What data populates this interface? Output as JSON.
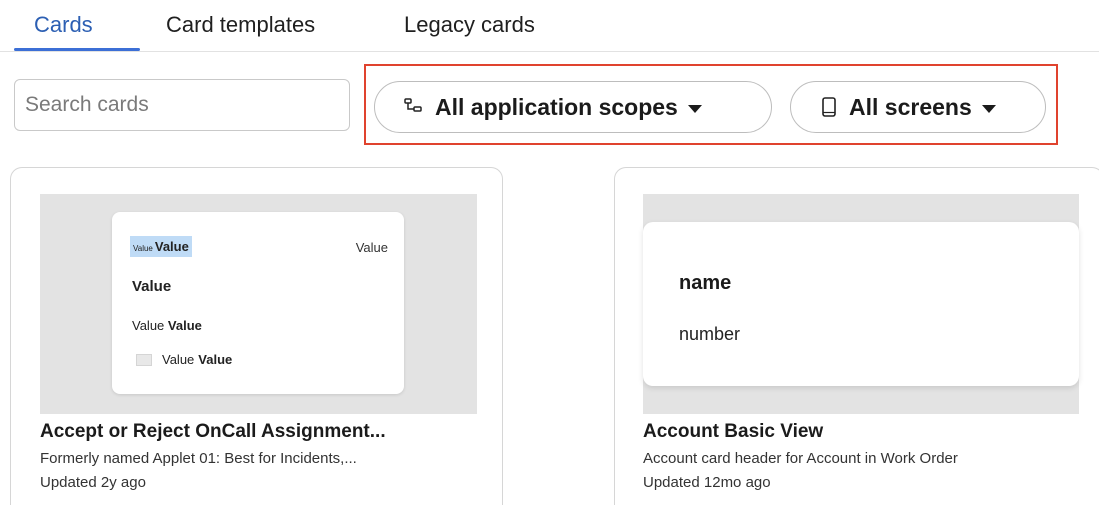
{
  "tabs": [
    {
      "label": "Cards",
      "active": true
    },
    {
      "label": "Card templates",
      "active": false
    },
    {
      "label": "Legacy cards",
      "active": false
    }
  ],
  "search": {
    "placeholder": "Search cards",
    "value": ""
  },
  "filters": {
    "scopes": {
      "label": "All application scopes",
      "icon": "hierarchy-icon"
    },
    "screens": {
      "label": "All screens",
      "icon": "mobile-device-icon"
    }
  },
  "cards": [
    {
      "preview": {
        "highlight_small": "Value",
        "highlight_bold": "Value",
        "top_right": "Value",
        "heading": "Value",
        "row_label": "Value",
        "row_value": "Value",
        "image_row_label": "Value",
        "image_row_value": "Value"
      },
      "title": "Accept or Reject OnCall Assignment...",
      "description": "Formerly named Applet 01: Best for Incidents,...",
      "updated": "Updated 2y ago"
    },
    {
      "preview": {
        "name": "name",
        "number": "number"
      },
      "title": "Account Basic View",
      "description": "Account card header for Account in Work Order",
      "updated": "Updated 12mo ago"
    }
  ],
  "colors": {
    "accent": "#3c6fd6",
    "highlight_border": "#e0432e",
    "preview_bg": "#e3e3e3"
  }
}
